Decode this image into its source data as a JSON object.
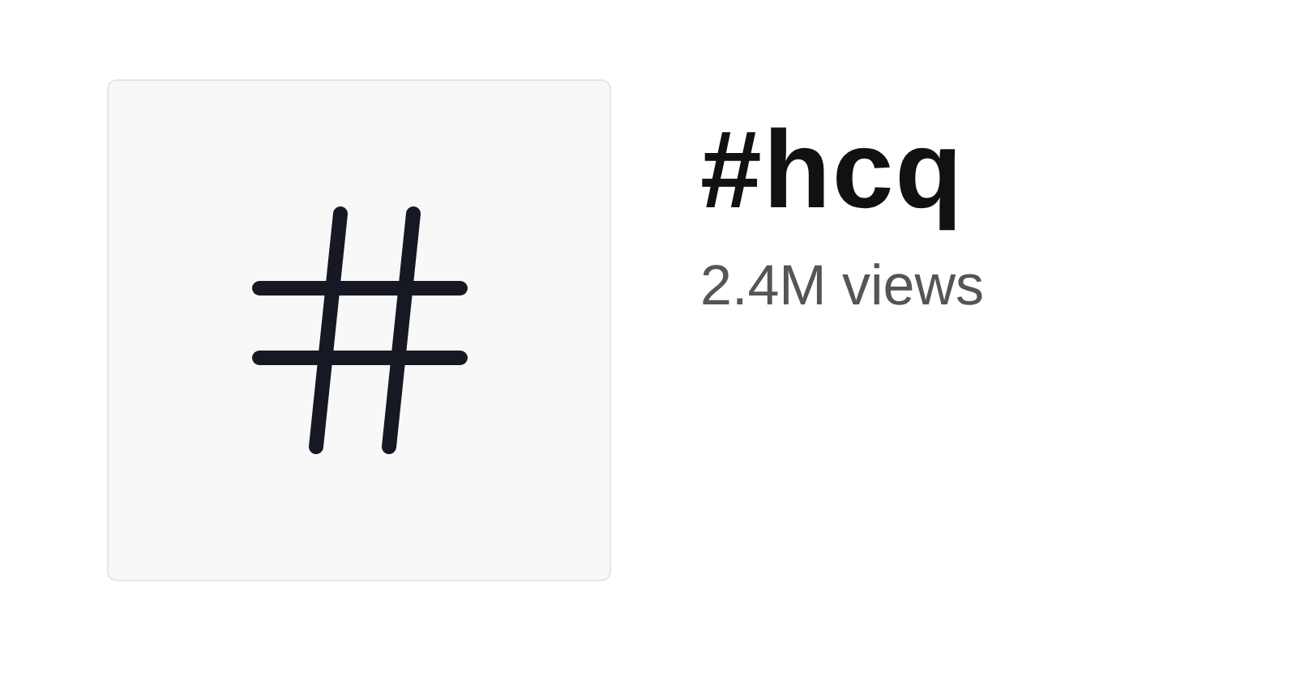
{
  "hashtag": {
    "title": "#hcq",
    "views": "2.4M views"
  }
}
